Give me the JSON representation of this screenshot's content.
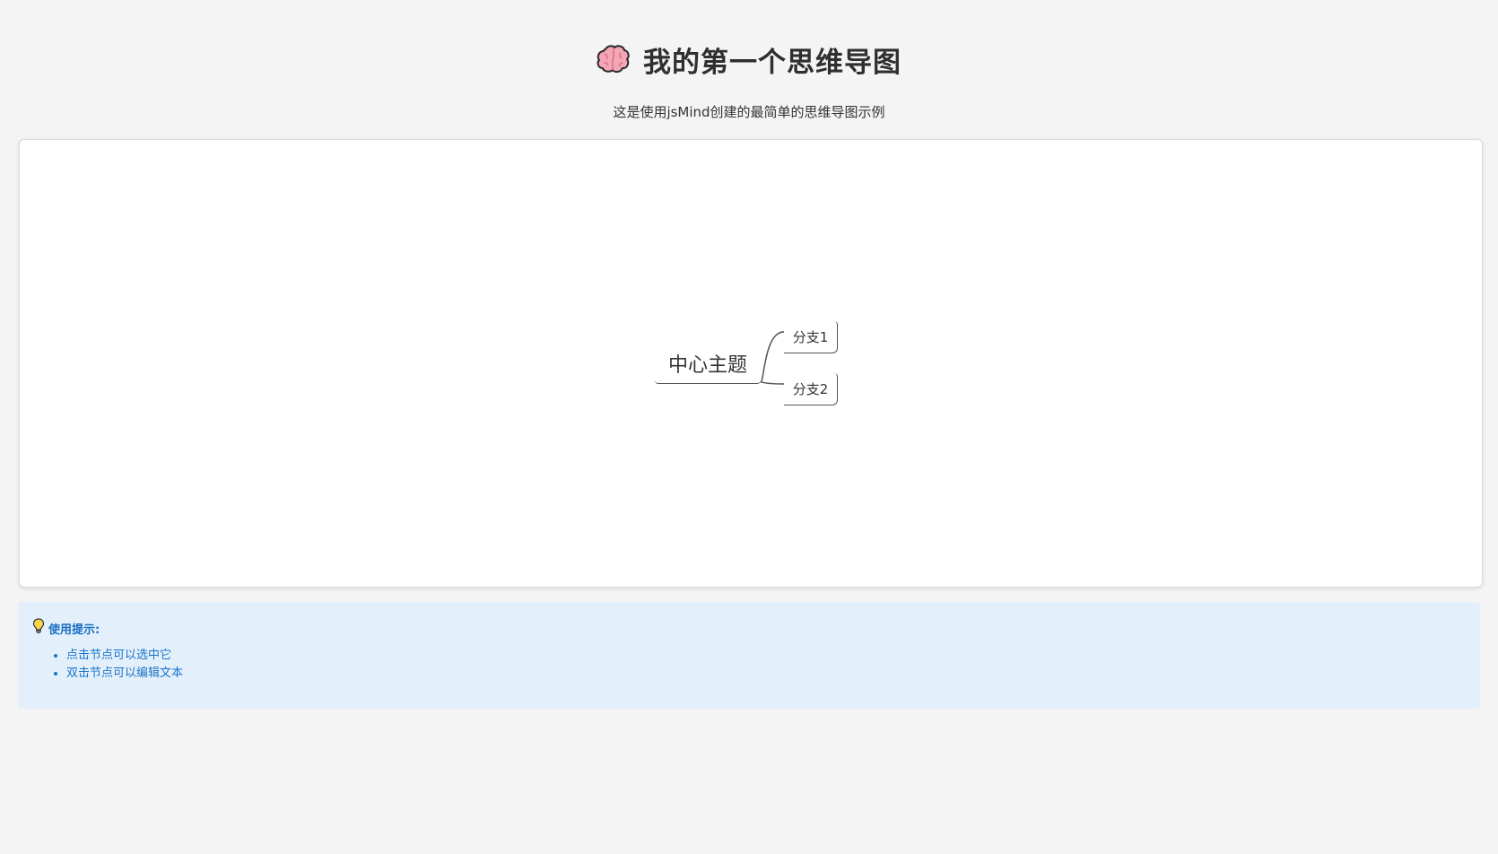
{
  "header": {
    "title": "我的第一个思维导图",
    "icon": "brain-icon",
    "subtitle": "这是使用jsMind创建的最简单的思维导图示例"
  },
  "mindmap": {
    "root": {
      "topic": "中心主题"
    },
    "children": [
      {
        "topic": "分支1",
        "direction": "right"
      },
      {
        "topic": "分支2",
        "direction": "right"
      }
    ]
  },
  "tips": {
    "icon": "lightbulb-icon",
    "title": "使用提示:",
    "items": [
      "点击节点可以选中它",
      "双击节点可以编辑文本"
    ]
  },
  "colors": {
    "page_background": "#f4f4f4",
    "canvas_background": "#ffffff",
    "tips_background": "#e3f0fb",
    "tips_text": "#1a73c9",
    "line_color": "#555555"
  }
}
